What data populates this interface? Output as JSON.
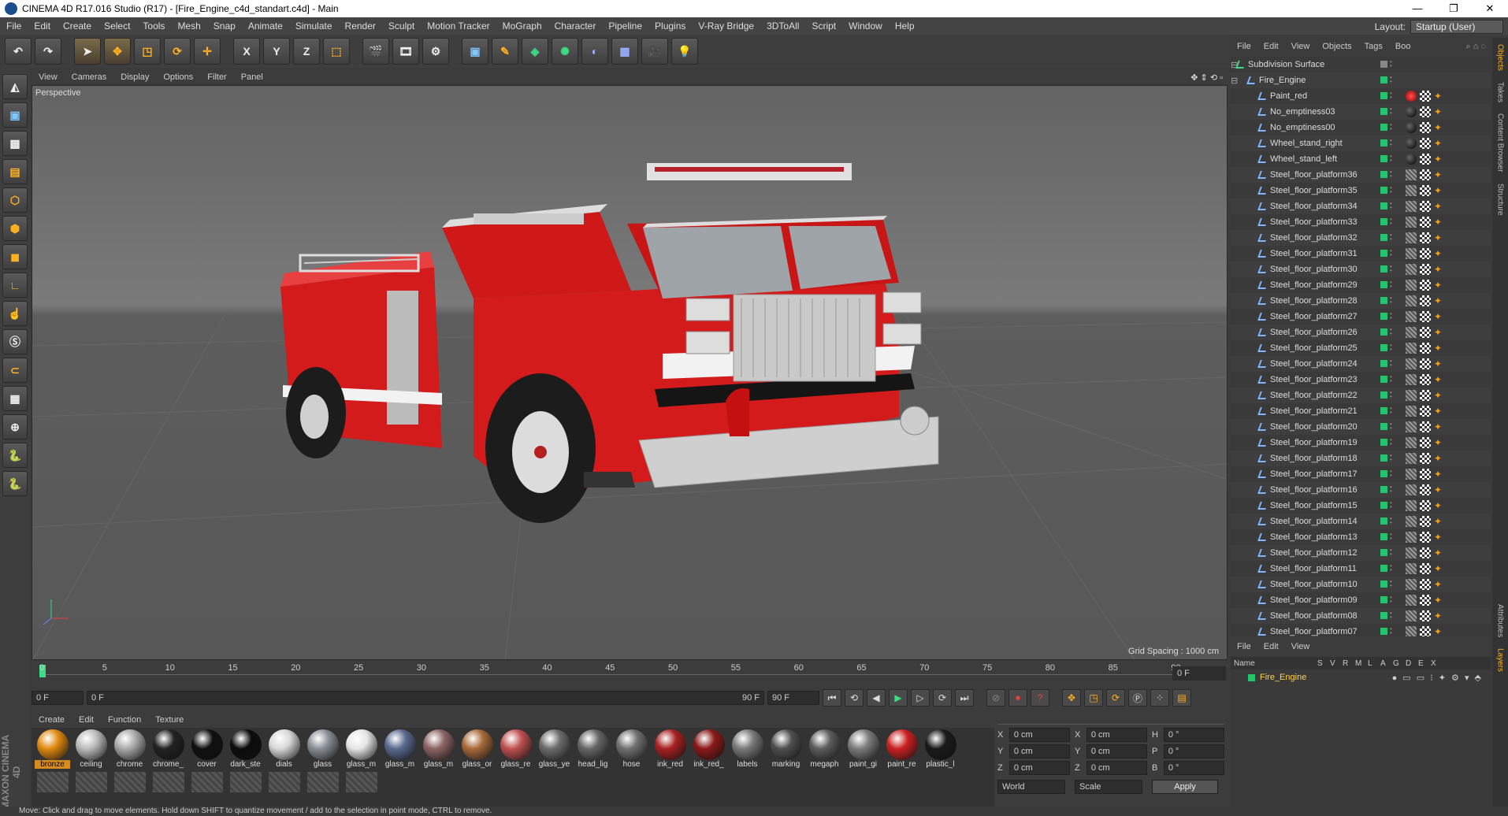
{
  "window": {
    "title": "CINEMA 4D R17.016 Studio (R17) - [Fire_Engine_c4d_standart.c4d] - Main"
  },
  "menubar": {
    "items": [
      "File",
      "Edit",
      "Create",
      "Select",
      "Tools",
      "Mesh",
      "Snap",
      "Animate",
      "Simulate",
      "Render",
      "Sculpt",
      "Motion Tracker",
      "MoGraph",
      "Character",
      "Pipeline",
      "Plugins",
      "V-Ray Bridge",
      "3DToAll",
      "Script",
      "Window",
      "Help"
    ],
    "layout_label": "Layout:",
    "layout_value": "Startup (User)"
  },
  "toolbar": {
    "x_label": "X",
    "y_label": "Y",
    "z_label": "Z"
  },
  "viewport": {
    "menu": [
      "View",
      "Cameras",
      "Display",
      "Options",
      "Filter",
      "Panel"
    ],
    "label": "Perspective",
    "grid_spacing": "Grid Spacing : 1000 cm"
  },
  "timeline": {
    "ticks": [
      "0",
      "5",
      "10",
      "15",
      "20",
      "25",
      "30",
      "35",
      "40",
      "45",
      "50",
      "55",
      "60",
      "65",
      "70",
      "75",
      "80",
      "85",
      "90"
    ],
    "current_frame": "0 F"
  },
  "playback": {
    "start": "0 F",
    "slider_left": "0 F",
    "slider_right": "90 F",
    "end": "90 F"
  },
  "materials": {
    "menu": [
      "Create",
      "Edit",
      "Function",
      "Texture"
    ],
    "items": [
      {
        "name": "bronze",
        "color": "#e08a10"
      },
      {
        "name": "ceiling",
        "color": "#bcbcbc"
      },
      {
        "name": "chrome",
        "color": "#aaaaaa"
      },
      {
        "name": "chrome_",
        "color": "#222222"
      },
      {
        "name": "cover",
        "color": "#101010"
      },
      {
        "name": "dark_ste",
        "color": "#0c0c0c"
      },
      {
        "name": "dials",
        "color": "#d8d8d8"
      },
      {
        "name": "glass",
        "color": "#8a8f96"
      },
      {
        "name": "glass_m",
        "color": "#e6e6e6"
      },
      {
        "name": "glass_m",
        "color": "#5a6a90"
      },
      {
        "name": "glass_m",
        "color": "#8c6464"
      },
      {
        "name": "glass_or",
        "color": "#a86a3a"
      },
      {
        "name": "glass_re",
        "color": "#c05050"
      },
      {
        "name": "glass_ye",
        "color": "#6c6c6c"
      },
      {
        "name": "head_lig",
        "color": "#666666"
      },
      {
        "name": "hose",
        "color": "#707070"
      },
      {
        "name": "ink_red",
        "color": "#a82020"
      },
      {
        "name": "ink_red_",
        "color": "#8c1818"
      },
      {
        "name": "labels",
        "color": "#7a7a7a"
      },
      {
        "name": "marking",
        "color": "#4e4e4e"
      },
      {
        "name": "megaph",
        "color": "#5c5c5c"
      },
      {
        "name": "paint_gi",
        "color": "#7c7c7c"
      },
      {
        "name": "paint_re",
        "color": "#cc2020"
      },
      {
        "name": "plastic_l",
        "color": "#1a1a1a"
      }
    ]
  },
  "coords": {
    "rows": [
      {
        "a": "X",
        "av": "0 cm",
        "b": "X",
        "bv": "0 cm",
        "c": "H",
        "cv": "0 °"
      },
      {
        "a": "Y",
        "av": "0 cm",
        "b": "Y",
        "bv": "0 cm",
        "c": "P",
        "cv": "0 °"
      },
      {
        "a": "Z",
        "av": "0 cm",
        "b": "Z",
        "bv": "0 cm",
        "c": "B",
        "cv": "0 °"
      }
    ],
    "world": "World",
    "scale": "Scale",
    "apply": "Apply"
  },
  "objects": {
    "menu": [
      "File",
      "Edit",
      "View",
      "Objects",
      "Tags",
      "Boo"
    ],
    "rows": [
      {
        "name": "Subdivision Surface",
        "indent": 0,
        "tag": "none"
      },
      {
        "name": "Fire_Engine",
        "indent": 1,
        "tag": "none"
      },
      {
        "name": "Paint_red",
        "indent": 2,
        "tag": "red"
      },
      {
        "name": "No_emptiness03",
        "indent": 2,
        "tag": "black"
      },
      {
        "name": "No_emptiness00",
        "indent": 2,
        "tag": "black"
      },
      {
        "name": "Wheel_stand_right",
        "indent": 2,
        "tag": "black"
      },
      {
        "name": "Wheel_stand_left",
        "indent": 2,
        "tag": "black"
      },
      {
        "name": "Steel_floor_platform36",
        "indent": 2,
        "tag": "grey"
      },
      {
        "name": "Steel_floor_platform35",
        "indent": 2,
        "tag": "grey"
      },
      {
        "name": "Steel_floor_platform34",
        "indent": 2,
        "tag": "grey"
      },
      {
        "name": "Steel_floor_platform33",
        "indent": 2,
        "tag": "grey"
      },
      {
        "name": "Steel_floor_platform32",
        "indent": 2,
        "tag": "grey"
      },
      {
        "name": "Steel_floor_platform31",
        "indent": 2,
        "tag": "grey"
      },
      {
        "name": "Steel_floor_platform30",
        "indent": 2,
        "tag": "grey"
      },
      {
        "name": "Steel_floor_platform29",
        "indent": 2,
        "tag": "grey"
      },
      {
        "name": "Steel_floor_platform28",
        "indent": 2,
        "tag": "grey"
      },
      {
        "name": "Steel_floor_platform27",
        "indent": 2,
        "tag": "grey"
      },
      {
        "name": "Steel_floor_platform26",
        "indent": 2,
        "tag": "grey"
      },
      {
        "name": "Steel_floor_platform25",
        "indent": 2,
        "tag": "grey"
      },
      {
        "name": "Steel_floor_platform24",
        "indent": 2,
        "tag": "grey"
      },
      {
        "name": "Steel_floor_platform23",
        "indent": 2,
        "tag": "grey"
      },
      {
        "name": "Steel_floor_platform22",
        "indent": 2,
        "tag": "grey"
      },
      {
        "name": "Steel_floor_platform21",
        "indent": 2,
        "tag": "grey"
      },
      {
        "name": "Steel_floor_platform20",
        "indent": 2,
        "tag": "grey"
      },
      {
        "name": "Steel_floor_platform19",
        "indent": 2,
        "tag": "grey"
      },
      {
        "name": "Steel_floor_platform18",
        "indent": 2,
        "tag": "grey"
      },
      {
        "name": "Steel_floor_platform17",
        "indent": 2,
        "tag": "grey"
      },
      {
        "name": "Steel_floor_platform16",
        "indent": 2,
        "tag": "grey"
      },
      {
        "name": "Steel_floor_platform15",
        "indent": 2,
        "tag": "grey"
      },
      {
        "name": "Steel_floor_platform14",
        "indent": 2,
        "tag": "grey"
      },
      {
        "name": "Steel_floor_platform13",
        "indent": 2,
        "tag": "grey"
      },
      {
        "name": "Steel_floor_platform12",
        "indent": 2,
        "tag": "grey"
      },
      {
        "name": "Steel_floor_platform11",
        "indent": 2,
        "tag": "grey"
      },
      {
        "name": "Steel_floor_platform10",
        "indent": 2,
        "tag": "grey"
      },
      {
        "name": "Steel_floor_platform09",
        "indent": 2,
        "tag": "grey"
      },
      {
        "name": "Steel_floor_platform08",
        "indent": 2,
        "tag": "grey"
      },
      {
        "name": "Steel_floor_platform07",
        "indent": 2,
        "tag": "grey"
      }
    ]
  },
  "attributes": {
    "menu": [
      "File",
      "Edit",
      "View"
    ],
    "head": [
      "Name",
      "S",
      "V",
      "R",
      "M",
      "L",
      "A",
      "G",
      "D",
      "E",
      "X"
    ],
    "row_name": "Fire_Engine"
  },
  "right_tabs": [
    "Objects",
    "Takes",
    "Content Browser",
    "Structure",
    "Attributes",
    "Layers"
  ],
  "status": "Move: Click and drag to move elements. Hold down SHIFT to quantize movement / add to the selection in point mode, CTRL to remove.",
  "colors": {
    "accent": "#d78a1e",
    "visible_green": "#23c46b",
    "truck_red": "#d11a1a"
  }
}
